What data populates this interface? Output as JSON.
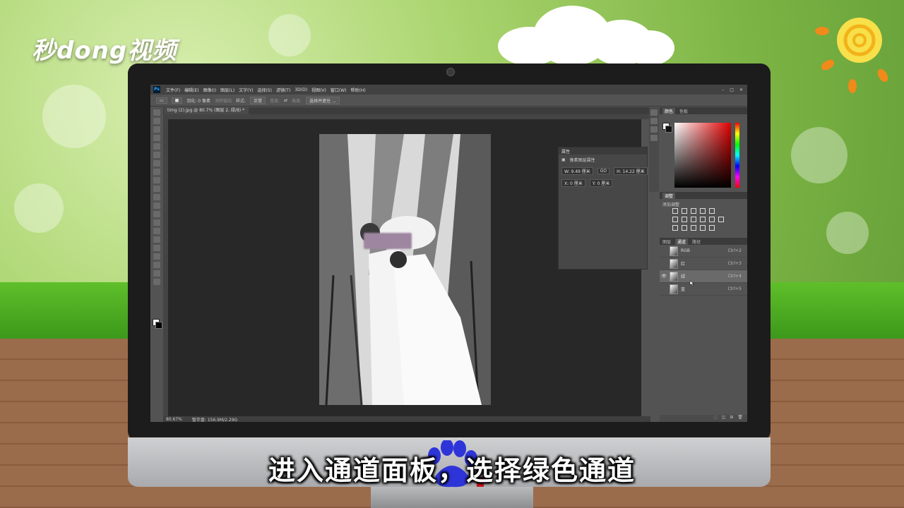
{
  "brand": {
    "logo_text": "秒dong视频"
  },
  "photoshop": {
    "menu": [
      "文件(F)",
      "编辑(E)",
      "图像(I)",
      "图层(L)",
      "文字(Y)",
      "选择(S)",
      "滤镜(T)",
      "3D(D)",
      "视图(V)",
      "窗口(W)",
      "帮助(H)"
    ],
    "options": {
      "feather": "羽化: 0 像素",
      "antialias": "消除锯齿",
      "style_label": "样式:",
      "style_value": "正常",
      "width_label": "宽度:",
      "height_label": "高度:",
      "select_mask_button": "选择并遮住 ..."
    },
    "document_tab": "timg (2).jpg @ 80.7% (图层 2, 绿/8) *",
    "status": {
      "zoom": "80.67%",
      "doc_info": "暂存盘: 156.9M/2.29G"
    },
    "properties_panel": {
      "title": "属性",
      "subtitle": "像素图层属性",
      "w": "W: 9.49 厘米",
      "link": "GO",
      "h": "H: 14.22 厘米",
      "x": "X: 0 厘米",
      "y": "Y: 0 厘米"
    },
    "color_panel": {
      "tabs": [
        "颜色",
        "色板"
      ]
    },
    "adjust_panel": {
      "title": "调整",
      "label": "添加调整"
    },
    "layers_panel": {
      "tabs": [
        "图层",
        "通道",
        "路径"
      ],
      "active_tab": "通道",
      "channels": [
        {
          "name": "RGB",
          "shortcut": "Ctrl+2",
          "visible": false,
          "selected": false
        },
        {
          "name": "红",
          "shortcut": "Ctrl+3",
          "visible": false,
          "selected": false
        },
        {
          "name": "绿",
          "shortcut": "Ctrl+4",
          "visible": true,
          "selected": true
        },
        {
          "name": "蓝",
          "shortcut": "Ctrl+5",
          "visible": false,
          "selected": false
        }
      ]
    }
  },
  "subtitle": "进入通道面板，选择绿色通道",
  "colors": {
    "ps_bg": "#535353",
    "canvas": "#282828",
    "subtitle_text": "#ffffff"
  }
}
